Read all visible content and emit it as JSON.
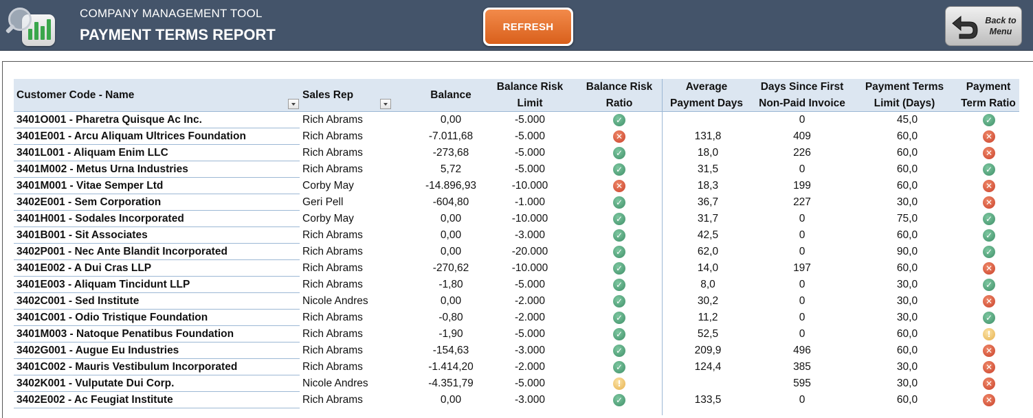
{
  "header": {
    "app_title": "COMPANY MANAGEMENT TOOL",
    "report_title": "PAYMENT TERMS REPORT",
    "refresh_label": "REFRESH",
    "back_label_line1": "Back to",
    "back_label_line2": "Menu"
  },
  "colors": {
    "header_bg": "#44546a",
    "table_header_bg": "#dce6f1",
    "refresh_button": "#e8722f",
    "status_ok": "#4e9e75",
    "status_bad": "#d2553c",
    "status_warn": "#f0c266"
  },
  "columns": {
    "name": "Customer Code - Name",
    "rep": "Sales Rep",
    "balance": "Balance",
    "risk_limit_1": "Balance Risk",
    "risk_limit_2": "Limit",
    "risk_ratio_1": "Balance Risk",
    "risk_ratio_2": "Ratio",
    "avg_1": "Average",
    "avg_2": "Payment Days",
    "days_1": "Days Since First",
    "days_2": "Non-Paid Invoice",
    "ptl_1": "Payment Terms",
    "ptl_2": "Limit (Days)",
    "ptr_1": "Payment",
    "ptr_2": "Term Ratio"
  },
  "rows": [
    {
      "name": "3401O001 - Pharetra Quisque Ac Inc.",
      "rep": "Rich Abrams",
      "balance": "0,00",
      "limit": "-5.000",
      "risk": "ok",
      "avg": "",
      "days": "0",
      "ptl": "45,0",
      "ptr": "ok"
    },
    {
      "name": "3401E001 - Arcu Aliquam Ultrices Foundation",
      "rep": "Rich Abrams",
      "balance": "-7.011,68",
      "limit": "-5.000",
      "risk": "bad",
      "avg": "131,8",
      "days": "409",
      "ptl": "60,0",
      "ptr": "bad"
    },
    {
      "name": "3401L001 - Aliquam Enim LLC",
      "rep": "Rich Abrams",
      "balance": "-273,68",
      "limit": "-5.000",
      "risk": "ok",
      "avg": "18,0",
      "days": "226",
      "ptl": "60,0",
      "ptr": "bad"
    },
    {
      "name": "3401M002 - Metus Urna Industries",
      "rep": "Rich Abrams",
      "balance": "5,72",
      "limit": "-5.000",
      "risk": "ok",
      "avg": "31,5",
      "days": "0",
      "ptl": "60,0",
      "ptr": "ok"
    },
    {
      "name": "3401M001 - Vitae Semper Ltd",
      "rep": "Corby May",
      "balance": "-14.896,93",
      "limit": "-10.000",
      "risk": "bad",
      "avg": "18,3",
      "days": "199",
      "ptl": "60,0",
      "ptr": "bad"
    },
    {
      "name": "3402E001 - Sem Corporation",
      "rep": "Geri Pell",
      "balance": "-604,80",
      "limit": "-1.000",
      "risk": "ok",
      "avg": "36,7",
      "days": "227",
      "ptl": "30,0",
      "ptr": "bad"
    },
    {
      "name": "3401H001 - Sodales Incorporated",
      "rep": "Corby May",
      "balance": "0,00",
      "limit": "-10.000",
      "risk": "ok",
      "avg": "31,7",
      "days": "0",
      "ptl": "75,0",
      "ptr": "ok"
    },
    {
      "name": "3401B001 - Sit Associates",
      "rep": "Rich Abrams",
      "balance": "0,00",
      "limit": "-3.000",
      "risk": "ok",
      "avg": "42,5",
      "days": "0",
      "ptl": "60,0",
      "ptr": "ok"
    },
    {
      "name": "3402P001 - Nec Ante Blandit Incorporated",
      "rep": "Rich Abrams",
      "balance": "0,00",
      "limit": "-20.000",
      "risk": "ok",
      "avg": "62,0",
      "days": "0",
      "ptl": "90,0",
      "ptr": "ok"
    },
    {
      "name": "3401E002 - A Dui Cras LLP",
      "rep": "Rich Abrams",
      "balance": "-270,62",
      "limit": "-10.000",
      "risk": "ok",
      "avg": "14,0",
      "days": "197",
      "ptl": "60,0",
      "ptr": "bad"
    },
    {
      "name": "3401E003 - Aliquam Tincidunt LLP",
      "rep": "Rich Abrams",
      "balance": "-1,80",
      "limit": "-5.000",
      "risk": "ok",
      "avg": "8,0",
      "days": "0",
      "ptl": "30,0",
      "ptr": "ok"
    },
    {
      "name": "3402C001 - Sed Institute",
      "rep": "Nicole Andres",
      "balance": "0,00",
      "limit": "-2.000",
      "risk": "ok",
      "avg": "30,2",
      "days": "0",
      "ptl": "30,0",
      "ptr": "bad"
    },
    {
      "name": "3401C001 - Odio Tristique Foundation",
      "rep": "Rich Abrams",
      "balance": "-0,80",
      "limit": "-2.000",
      "risk": "ok",
      "avg": "11,2",
      "days": "0",
      "ptl": "30,0",
      "ptr": "ok"
    },
    {
      "name": "3401M003 - Natoque Penatibus Foundation",
      "rep": "Rich Abrams",
      "balance": "-1,90",
      "limit": "-5.000",
      "risk": "ok",
      "avg": "52,5",
      "days": "0",
      "ptl": "60,0",
      "ptr": "warn"
    },
    {
      "name": "3402G001 - Augue Eu Industries",
      "rep": "Rich Abrams",
      "balance": "-154,63",
      "limit": "-3.000",
      "risk": "ok",
      "avg": "209,9",
      "days": "496",
      "ptl": "60,0",
      "ptr": "bad"
    },
    {
      "name": "3401C002 - Mauris Vestibulum Incorporated",
      "rep": "Rich Abrams",
      "balance": "-1.414,20",
      "limit": "-2.000",
      "risk": "ok",
      "avg": "124,4",
      "days": "385",
      "ptl": "30,0",
      "ptr": "bad"
    },
    {
      "name": "3402K001 - Vulputate Dui Corp.",
      "rep": "Nicole Andres",
      "balance": "-4.351,79",
      "limit": "-5.000",
      "risk": "warn",
      "avg": "",
      "days": "595",
      "ptl": "30,0",
      "ptr": "bad"
    },
    {
      "name": "3402E002 - Ac Feugiat Institute",
      "rep": "Rich Abrams",
      "balance": "0,00",
      "limit": "-3.000",
      "risk": "ok",
      "avg": "133,5",
      "days": "0",
      "ptl": "60,0",
      "ptr": "bad"
    }
  ]
}
